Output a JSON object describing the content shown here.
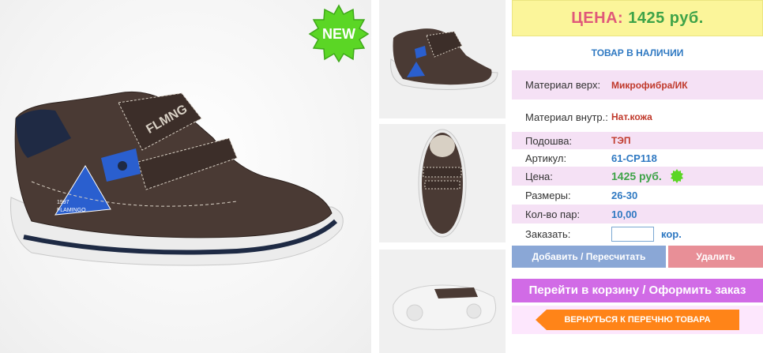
{
  "badge": {
    "new_label": "NEW"
  },
  "price": {
    "label": "ЦЕНА:",
    "value": "1425 руб."
  },
  "stock": "ТОВАР В НАЛИЧИИ",
  "attributes": [
    {
      "key": "Материал верх:",
      "value": "Микрофибра/ИК"
    },
    {
      "key": "Материал внутр.:",
      "value": "Нат.кожа"
    },
    {
      "key": "Подошва:",
      "value": "ТЭП"
    },
    {
      "key": "Артикул:",
      "value": "61-CP118"
    },
    {
      "key": "Цена:",
      "value": "1425 руб."
    },
    {
      "key": "Размеры:",
      "value": "26-30"
    },
    {
      "key": "Кол-во пар:",
      "value": "10,00"
    }
  ],
  "order": {
    "label": "Заказать:",
    "value": "",
    "unit": "кор."
  },
  "buttons": {
    "add": "Добавить / Пересчитать",
    "delete": "Удалить",
    "cart": "Перейти в корзину / Оформить заказ",
    "back": "ВЕРНУТЬСЯ К ПЕРЕЧНЮ ТОВАРА"
  },
  "product_print": {
    "brand_text": "FLMNG",
    "logo_text": "1997 FLAMINGO"
  },
  "colors": {
    "price_label": "#e0587a",
    "price_value": "#3ea348",
    "stock": "#2f79c2",
    "add_button": "#8aa7d6",
    "delete_button": "#e88f97",
    "cart_button": "#d16be6",
    "back_button": "#ff8418"
  }
}
